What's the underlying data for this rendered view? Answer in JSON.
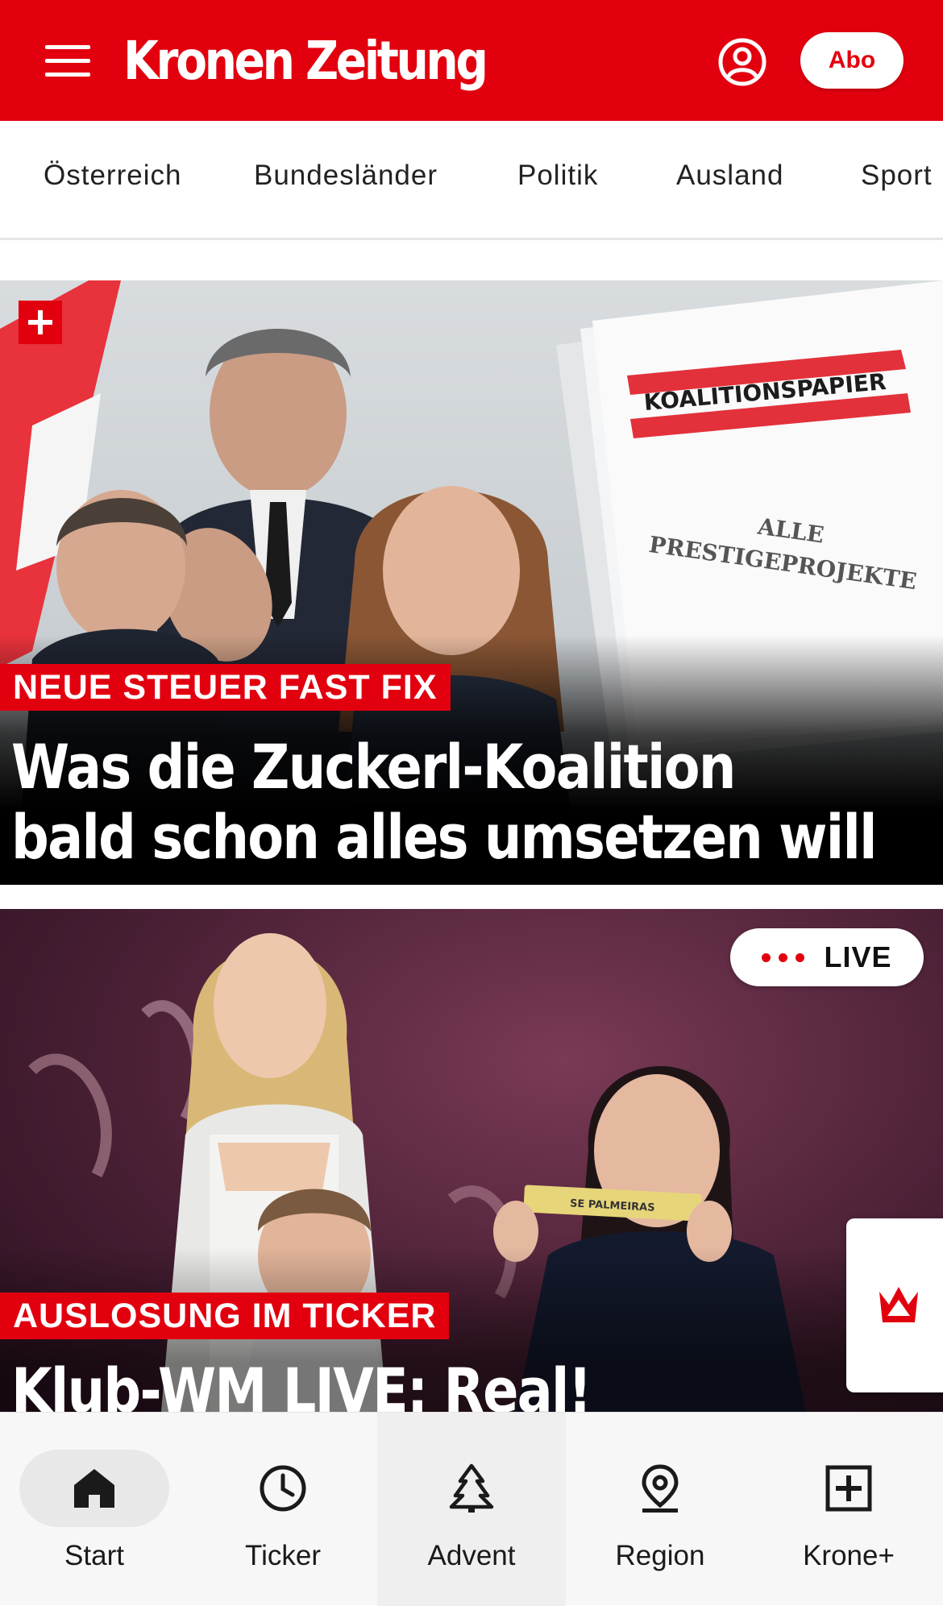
{
  "header": {
    "logo_text": "Kronen Zeitung",
    "abo_label": "Abo",
    "brand_color": "#e2000f",
    "menu_icon": "hamburger-icon",
    "user_icon": "user-account-icon"
  },
  "categories": [
    "Österreich",
    "Bundesländer",
    "Politik",
    "Ausland",
    "Sport"
  ],
  "articles": [
    {
      "badge_icon": "plus-icon",
      "image_text_1": "KOALITIONSPAPIER",
      "image_text_2": "ALLE",
      "image_text_3": "PRESTIGEPROJEKTE",
      "kicker": "NEUE STEUER FAST FIX",
      "headline_line1": "Was die Zuckerl-Koalition",
      "headline_line2": "bald schon alles umsetzen will"
    },
    {
      "live_label": "LIVE",
      "image_text": "SE PALMEIRAS",
      "kicker": "AUSLOSUNG IM TICKER",
      "headline": "Klub-WM LIVE: Real!"
    }
  ],
  "side_tab_icon": "crown-icon",
  "bottom_nav": [
    {
      "label": "Start",
      "icon": "home-icon",
      "active": true
    },
    {
      "label": "Ticker",
      "icon": "clock-icon"
    },
    {
      "label": "Advent",
      "icon": "tree-icon"
    },
    {
      "label": "Region",
      "icon": "location-pin-icon"
    },
    {
      "label": "Krone+",
      "icon": "plus-square-icon"
    }
  ]
}
